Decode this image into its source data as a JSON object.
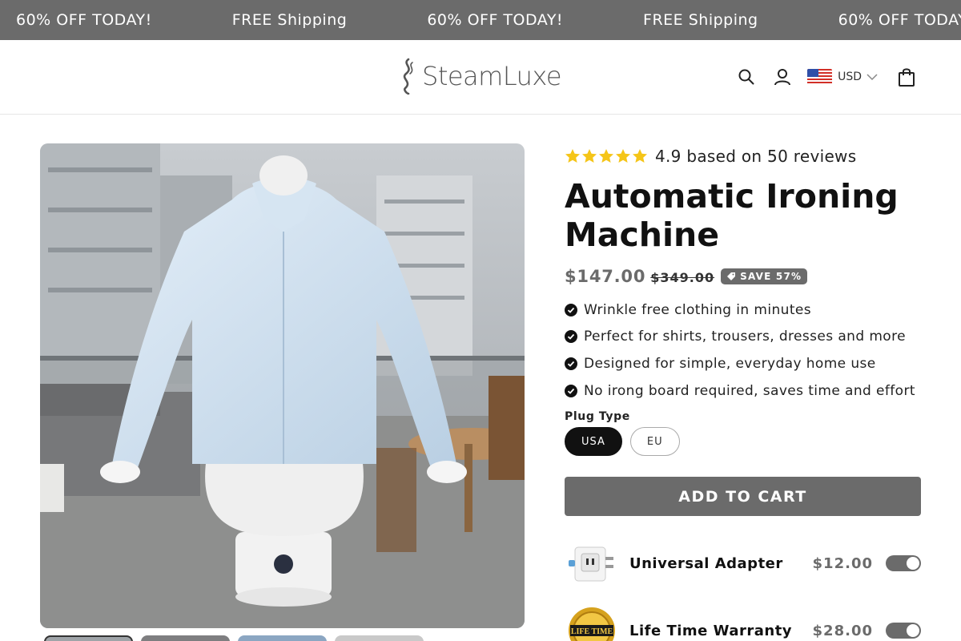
{
  "announcement": {
    "items": [
      "60% OFF TODAY!",
      "FREE Shipping",
      "60% OFF TODAY!",
      "FREE Shipping",
      "60% OFF TODAY!"
    ]
  },
  "header": {
    "logo_text": "SteamLuxe",
    "currency": "USD"
  },
  "product": {
    "rating_text": "4.9 based on 50 reviews",
    "rating_value": 4.9,
    "stars": 5,
    "title": "Automatic Ironing Machine",
    "price": "$147.00",
    "compare_price": "$349.00",
    "save_badge": "SAVE 57%",
    "benefits": [
      "Wrinkle free clothing in minutes",
      "Perfect for shirts, trousers, dresses and more",
      "Designed for simple, everyday home use",
      "No irong board required, saves time and effort"
    ],
    "plug_label": "Plug Type",
    "plug_options": [
      "USA",
      "EU"
    ],
    "plug_selected": "USA",
    "add_to_cart": "ADD TO CART",
    "addons": [
      {
        "name": "Universal Adapter",
        "price": "$12.00",
        "enabled": true
      },
      {
        "name": "Life Time Warranty",
        "price": "$28.00",
        "enabled": true
      }
    ],
    "warranty_badge_text": "LIFE TIME",
    "thumbnail_count": 4
  },
  "colors": {
    "accent_gray": "#6b6b6b",
    "star_gold": "#f5c518",
    "text_dark": "#121212"
  }
}
